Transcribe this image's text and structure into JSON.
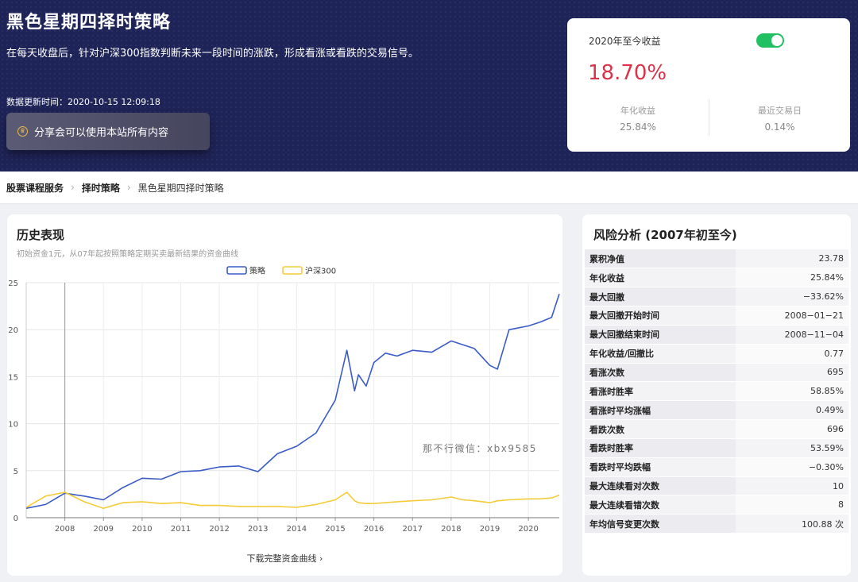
{
  "header": {
    "title": "黑色星期四择时策略",
    "description": "在每天收盘后，针对沪深300指数判断未来一段时间的涨跌，形成看涨或看跌的交易信号。",
    "updated": "数据更新时间：2020-10-15 12:09:18",
    "share_label": "分享会可以使用本站所有内容",
    "share_icon": "crown-icon"
  },
  "returns": {
    "label": "2020年至今收益",
    "value": "18.70%",
    "annual_label": "年化收益",
    "annual_value": "25.84%",
    "recent_label": "最近交易日",
    "recent_value": "0.14%",
    "toggle_on": true,
    "value_color": "#d9334a"
  },
  "breadcrumb": [
    "股票课程服务",
    "择时策略",
    "黑色星期四择时策略"
  ],
  "history": {
    "title": "历史表现",
    "subtitle": "初始资金1元，从07年起按照策略定期买卖最新结果的资金曲线",
    "watermark": "那不行微信：xbx9585",
    "download": "下载完整资金曲线  ›"
  },
  "chart_data": {
    "type": "line",
    "x": [
      2007.0,
      2007.5,
      2008.0,
      2008.5,
      2009.0,
      2009.5,
      2010.0,
      2010.5,
      2011.0,
      2011.5,
      2012.0,
      2012.5,
      2013.0,
      2013.5,
      2014.0,
      2014.5,
      2015.0,
      2015.3,
      2015.5,
      2015.6,
      2015.8,
      2016.0,
      2016.3,
      2016.6,
      2017.0,
      2017.5,
      2018.0,
      2018.3,
      2018.6,
      2019.0,
      2019.2,
      2019.5,
      2020.0,
      2020.3,
      2020.6,
      2020.8
    ],
    "series": [
      {
        "name": "策略",
        "color": "#3a5cc7",
        "values": [
          1.0,
          1.4,
          2.6,
          2.3,
          1.9,
          3.2,
          4.2,
          4.1,
          4.9,
          5.0,
          5.4,
          5.5,
          4.9,
          6.8,
          7.6,
          9.0,
          12.5,
          17.8,
          13.5,
          15.2,
          14.0,
          16.5,
          17.5,
          17.2,
          17.8,
          17.6,
          18.8,
          18.4,
          18.0,
          16.2,
          15.8,
          20.0,
          20.4,
          20.8,
          21.3,
          23.8
        ]
      },
      {
        "name": "沪深300",
        "color": "#f4cc3a",
        "values": [
          1.1,
          2.3,
          2.7,
          1.7,
          1.0,
          1.6,
          1.7,
          1.5,
          1.6,
          1.3,
          1.3,
          1.2,
          1.2,
          1.2,
          1.1,
          1.4,
          1.9,
          2.7,
          1.8,
          1.6,
          1.5,
          1.5,
          1.6,
          1.7,
          1.8,
          1.9,
          2.2,
          1.9,
          1.8,
          1.6,
          1.8,
          1.9,
          2.0,
          2.0,
          2.1,
          2.4
        ]
      }
    ],
    "ylim": [
      0,
      25
    ],
    "yticks": [
      "0",
      "5",
      "10",
      "15",
      "20",
      "25"
    ],
    "xticks": [
      "2008",
      "2009",
      "2010",
      "2011",
      "2012",
      "2013",
      "2014",
      "2015",
      "2016",
      "2017",
      "2018",
      "2019",
      "2020"
    ],
    "legend_position": "top-center",
    "grid": true
  },
  "risk": {
    "title": "风险分析 (2007年初至今)",
    "rows": [
      {
        "label": "累积净值",
        "value": "23.78"
      },
      {
        "label": "年化收益",
        "value": "25.84%"
      },
      {
        "label": "最大回撤",
        "value": "−33.62%"
      },
      {
        "label": "最大回撤开始时间",
        "value": "2008−01−21"
      },
      {
        "label": "最大回撤结束时间",
        "value": "2008−11−04"
      },
      {
        "label": "年化收益/回撤比",
        "value": "0.77"
      },
      {
        "label": "看涨次数",
        "value": "695"
      },
      {
        "label": "看涨时胜率",
        "value": "58.85%"
      },
      {
        "label": "看涨时平均涨幅",
        "value": "0.49%"
      },
      {
        "label": "看跌次数",
        "value": "696"
      },
      {
        "label": "看跌时胜率",
        "value": "53.59%"
      },
      {
        "label": "看跌时平均跌幅",
        "value": "−0.30%"
      },
      {
        "label": "最大连续看对次数",
        "value": "10"
      },
      {
        "label": "最大连续看错次数",
        "value": "8"
      },
      {
        "label": "年均信号变更次数",
        "value": "100.88 次"
      }
    ]
  }
}
